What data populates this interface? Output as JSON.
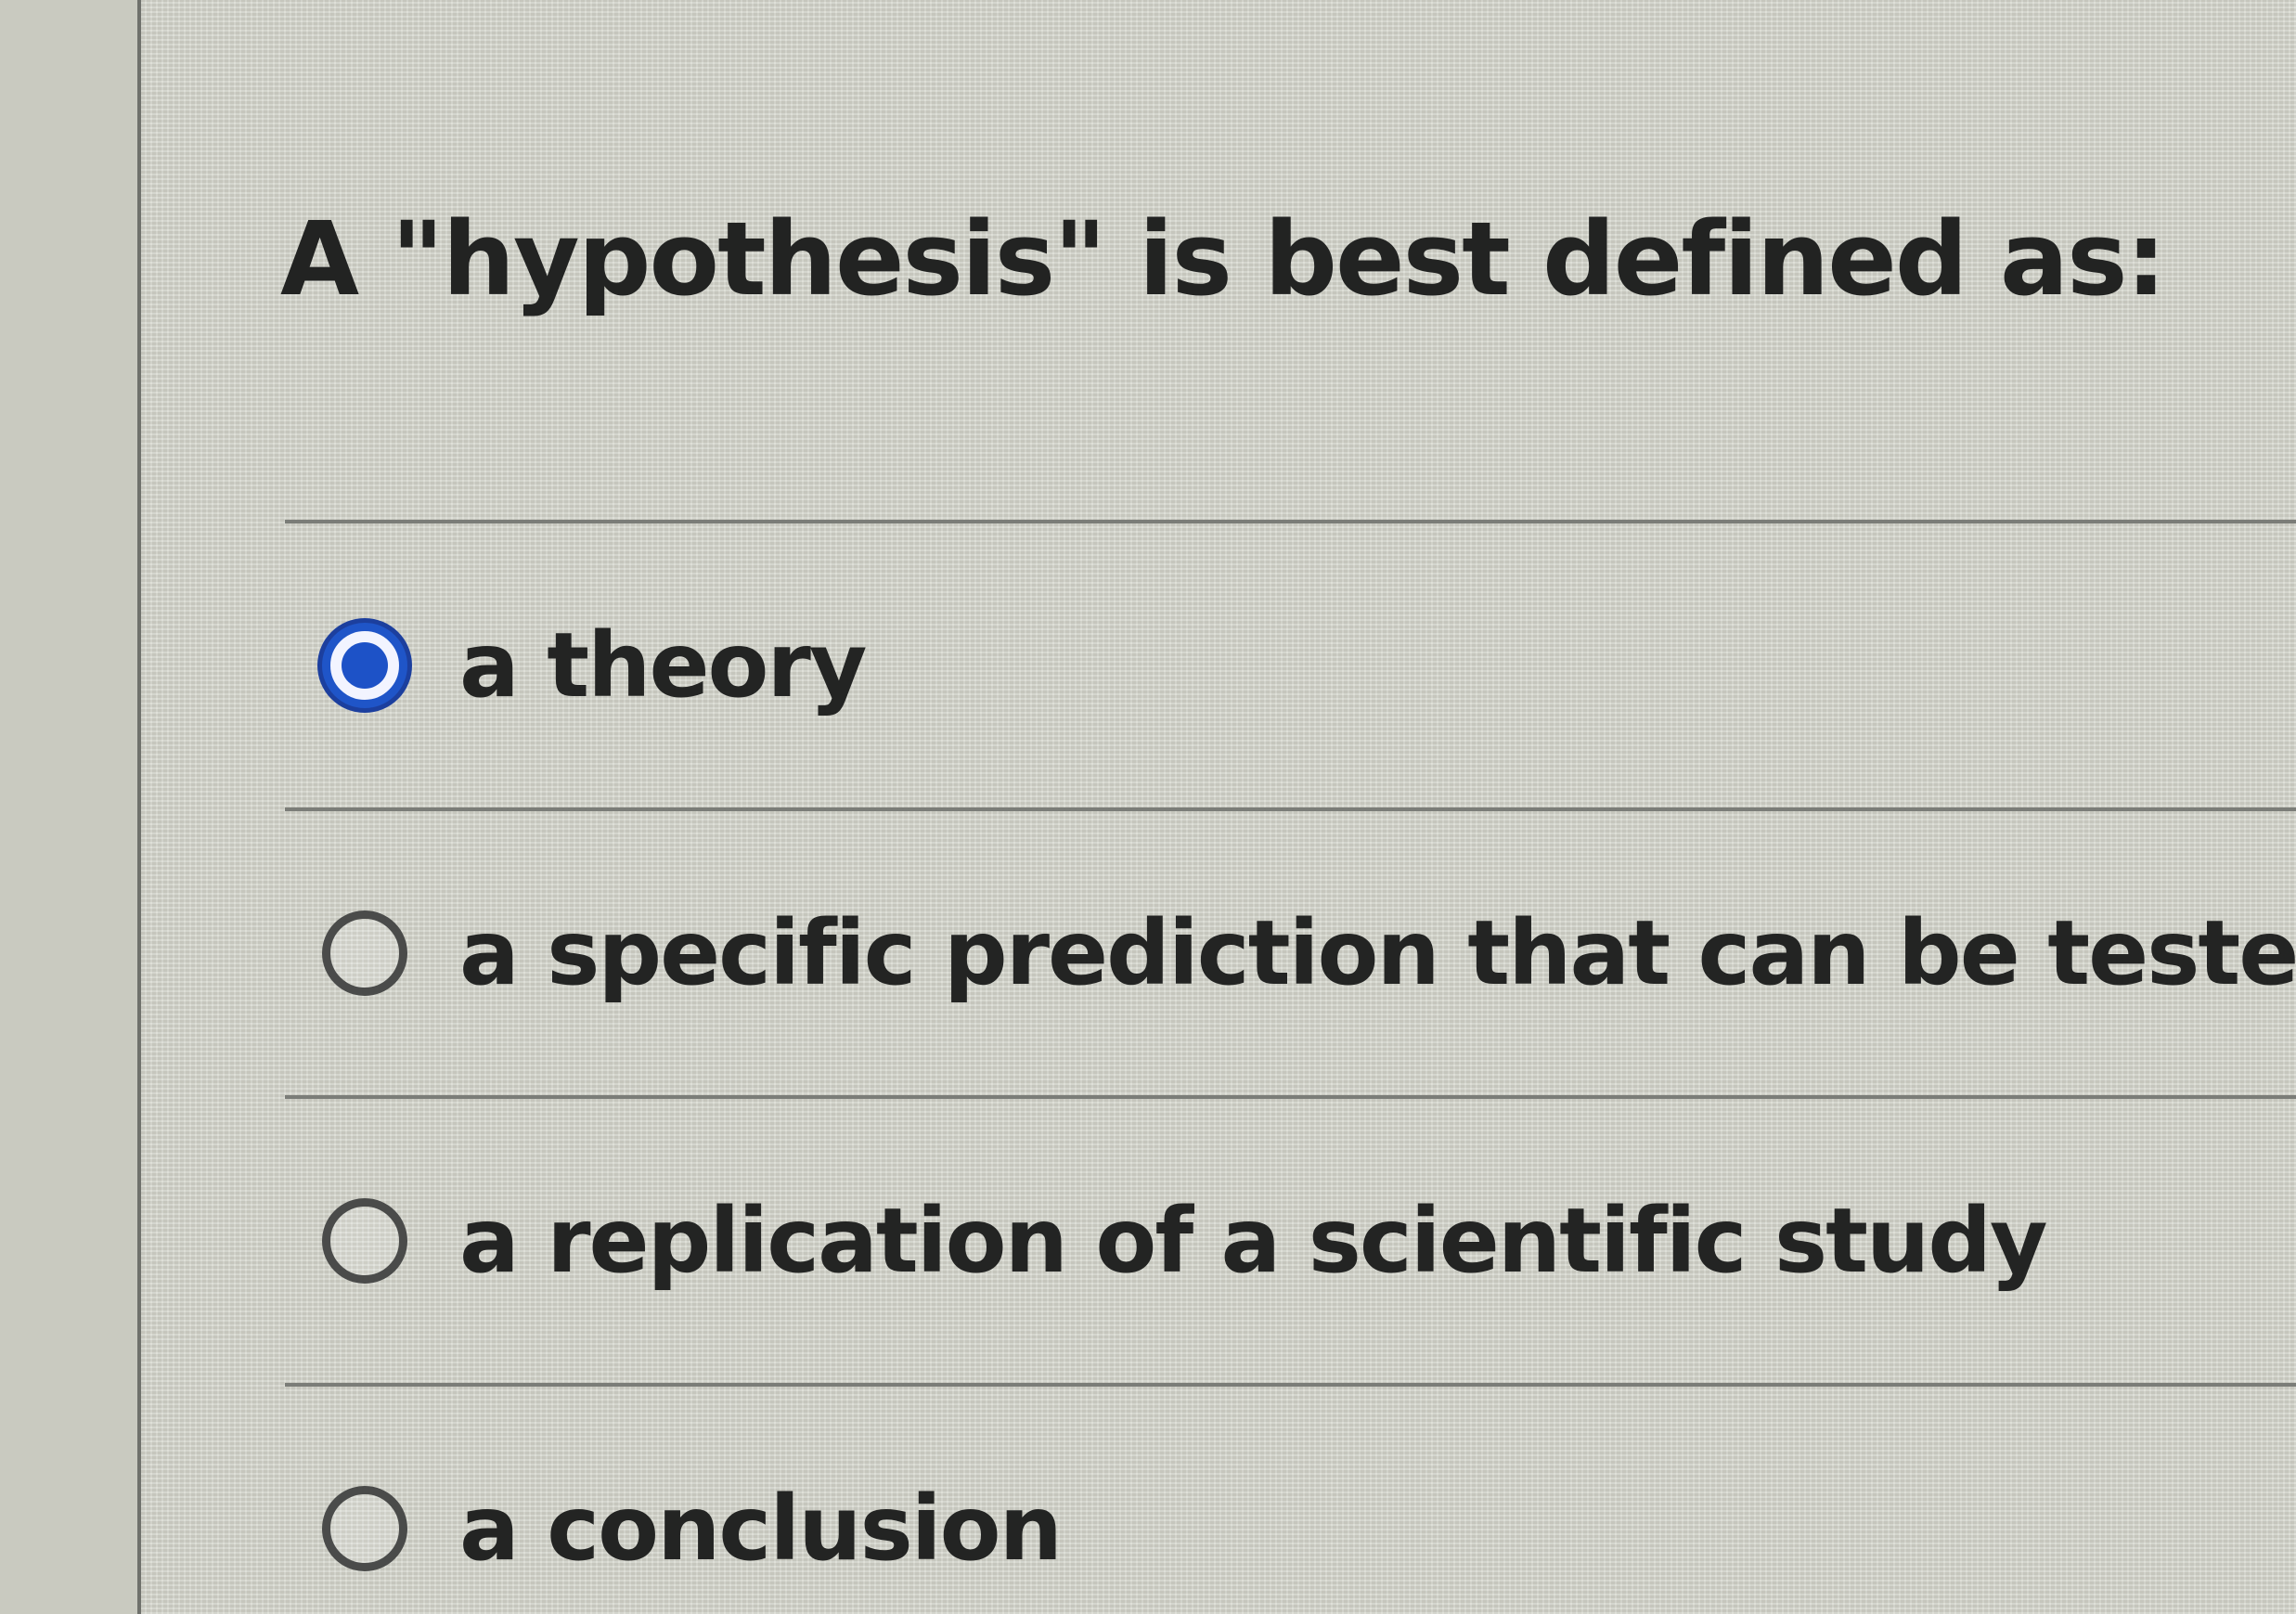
{
  "question": {
    "text": "A \"hypothesis\" is best defined as:"
  },
  "choices": [
    {
      "label": "a theory",
      "selected": true
    },
    {
      "label": "a specific prediction that can be tested",
      "selected": false
    },
    {
      "label": "a replication of a scientific study",
      "selected": false
    },
    {
      "label": "a conclusion",
      "selected": false
    }
  ],
  "colors": {
    "selected_radio": "#1d52c7",
    "background": "#d2d3c9",
    "text": "#232423"
  }
}
